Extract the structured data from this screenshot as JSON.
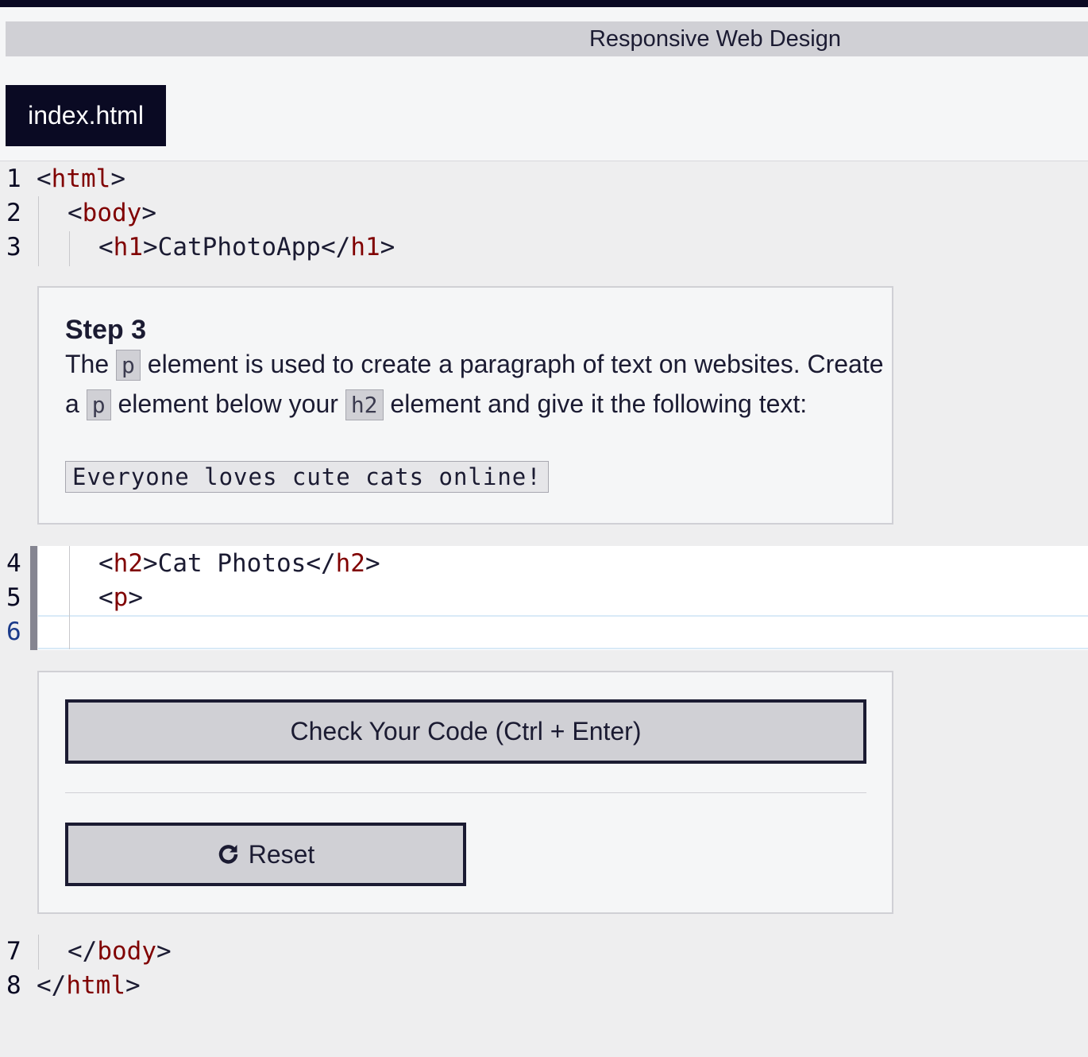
{
  "header": {
    "breadcrumb": "Responsive Web Design"
  },
  "tabs": [
    {
      "label": "index.html",
      "active": true
    }
  ],
  "editor": {
    "lines_before": [
      {
        "number": "1",
        "open": "<",
        "tag": "html",
        "close": ">",
        "text": ""
      },
      {
        "number": "2",
        "open": "<",
        "tag": "body",
        "close": ">",
        "text": ""
      },
      {
        "number": "3",
        "open": "<",
        "tag": "h1",
        "close": ">",
        "text": "CatPhotoApp",
        "end_open": "</",
        "end_tag": "h1",
        "end_close": ">"
      }
    ],
    "editable_lines": [
      {
        "number": "4",
        "open": "<",
        "tag": "h2",
        "close": ">",
        "text": "Cat Photos",
        "end_open": "</",
        "end_tag": "h2",
        "end_close": ">"
      },
      {
        "number": "5",
        "open": "<",
        "tag": "p",
        "close": ">"
      },
      {
        "number": "6"
      }
    ],
    "lines_after": [
      {
        "number": "7",
        "open": "</",
        "tag": "body",
        "close": ">"
      },
      {
        "number": "8",
        "open": "</",
        "tag": "html",
        "close": ">"
      }
    ]
  },
  "instructions": {
    "title": "Step 3",
    "line1": {
      "pre": "The ",
      "code1": "p",
      "post": " element is used to create a paragraph of text on websites. Create"
    },
    "line2": {
      "pre": "a ",
      "code1": "p",
      "mid": " element below your ",
      "code2": "h2",
      "post": " element and give it the following text:"
    },
    "sample": "Everyone loves cute cats online!"
  },
  "actions": {
    "check_label": "Check Your Code (Ctrl + Enter)",
    "reset_label": "Reset",
    "reset_icon": "reset-icon"
  },
  "colors": {
    "tag": "#800000",
    "dark": "#0a0a23",
    "button_bg": "#d0d0d5"
  }
}
